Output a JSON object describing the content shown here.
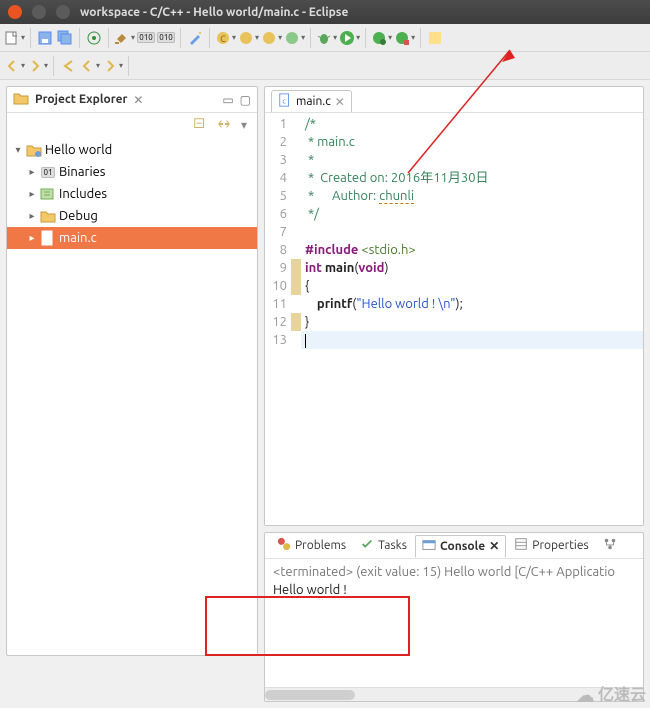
{
  "window": {
    "title": "workspace - C/C++ - Hello world/main.c - Eclipse"
  },
  "project_explorer": {
    "title": "Project Explorer",
    "close_glyph": "✕",
    "subtool_icons": [
      "collapse-icon",
      "link-icon",
      "menu-icon"
    ],
    "tree": {
      "root": {
        "expanded": true,
        "label": "Hello world"
      },
      "children": [
        {
          "expanded": false,
          "label": "Binaries",
          "icon": "binaries-icon"
        },
        {
          "expanded": false,
          "label": "Includes",
          "icon": "includes-icon"
        },
        {
          "expanded": false,
          "label": "Debug",
          "icon": "folder-icon"
        },
        {
          "expanded": false,
          "label": "main.c",
          "icon": "cfile-icon",
          "selected": true
        }
      ]
    }
  },
  "editor": {
    "tab": {
      "icon": "cfile-icon",
      "label": "main.c",
      "close": "✕"
    },
    "lines": [
      {
        "n": "1",
        "cls": "c-comment",
        "text": "/*"
      },
      {
        "n": "2",
        "cls": "c-comment",
        "text": " * main.c"
      },
      {
        "n": "3",
        "cls": "c-comment",
        "text": " *"
      },
      {
        "n": "4",
        "cls": "c-comment",
        "text": " *  Created on: 2016年11月30日"
      },
      {
        "n": "5",
        "cls": "c-comment",
        "text_pre": " *      Author: ",
        "underline": "chunli"
      },
      {
        "n": "6",
        "cls": "c-comment",
        "text": " */"
      },
      {
        "n": "7",
        "cls": "",
        "text": ""
      },
      {
        "n": "8",
        "cls": "",
        "html": "<span class=\"c-inc\">#include</span> <span class=\"c-header\">&lt;stdio.h&gt;</span>"
      },
      {
        "n": "9",
        "cls": "",
        "html": "<span class=\"c-kw\">int</span> <b>main</b>(<span class=\"c-kw\">void</span>)",
        "mark": true
      },
      {
        "n": "10",
        "cls": "",
        "text": "{",
        "mark": true
      },
      {
        "n": "11",
        "cls": "",
        "html": "    <b>printf</b>(<span class=\"c-str\">\"Hello world ! \\n\"</span>);"
      },
      {
        "n": "12",
        "cls": "",
        "text": "}",
        "mark": true
      },
      {
        "n": "13",
        "cls": "highlight-line",
        "text": "",
        "caret": true
      }
    ]
  },
  "bottom": {
    "tabs": [
      {
        "label": "Problems",
        "icon": "problems-icon"
      },
      {
        "label": "Tasks",
        "icon": "tasks-icon"
      },
      {
        "label": "Console",
        "icon": "console-icon",
        "active": true,
        "close": "✕"
      },
      {
        "label": "Properties",
        "icon": "properties-icon"
      }
    ],
    "console": {
      "status": "<terminated> (exit value: 15) Hello world [C/C++ Applicatio",
      "output": "Hello world !"
    }
  },
  "watermark": "亿速云"
}
